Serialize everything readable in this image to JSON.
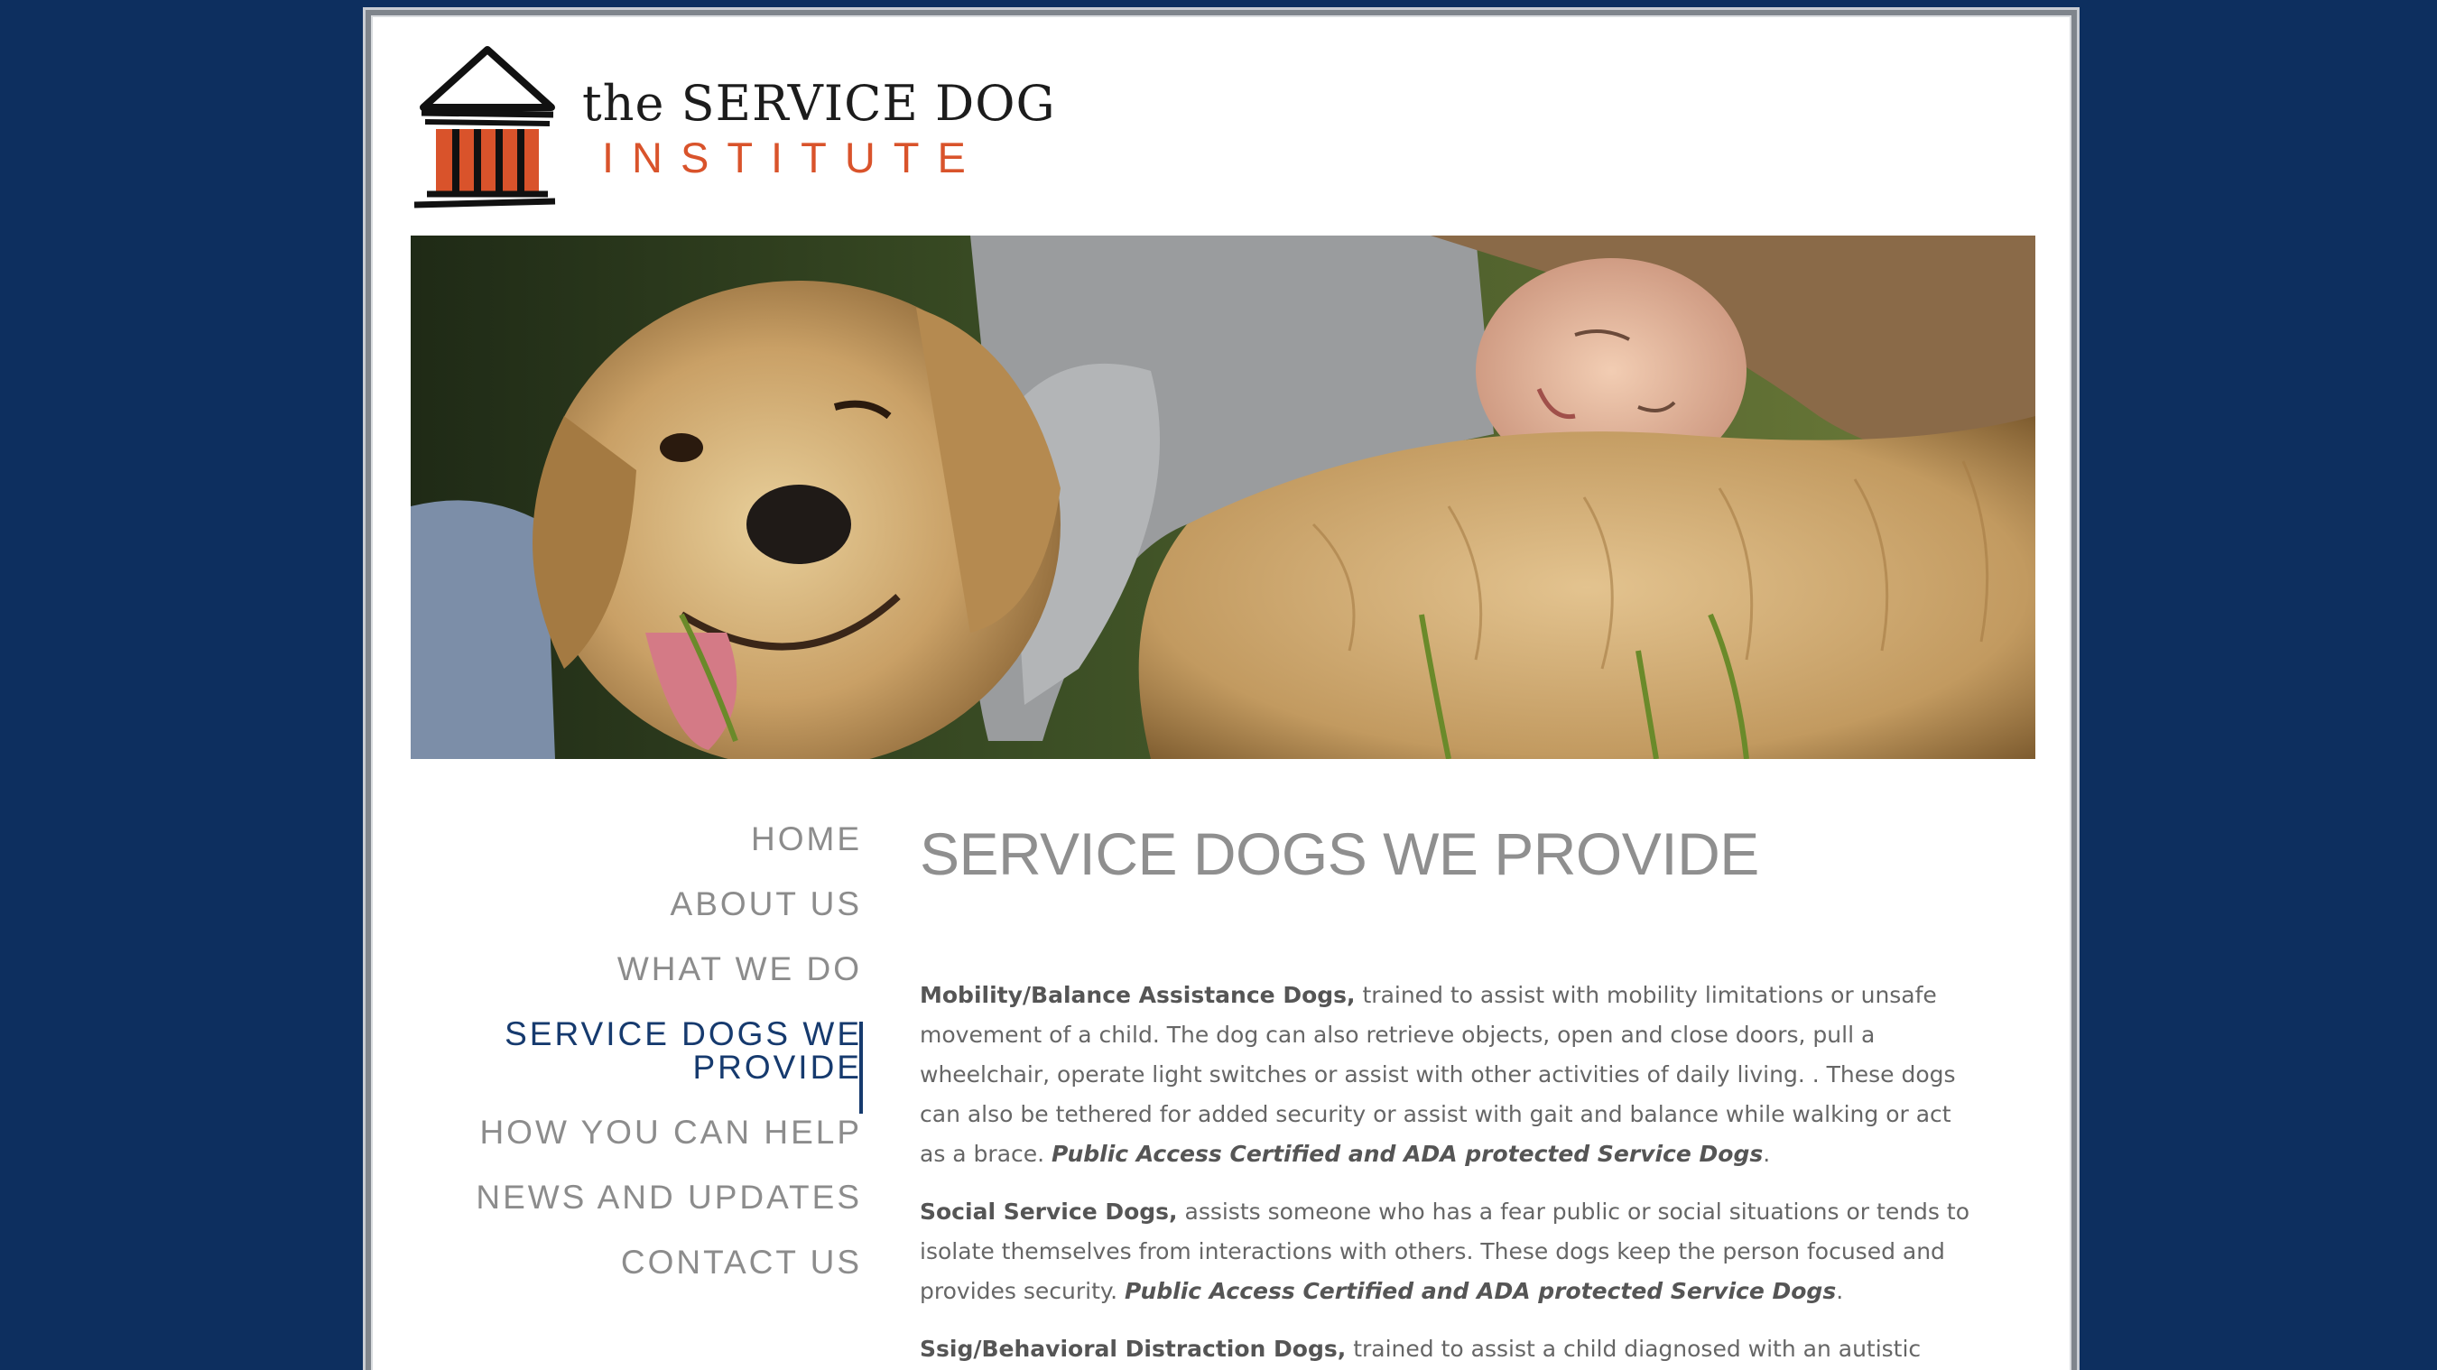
{
  "logo": {
    "line1": "the SERVICE DOG",
    "line2": "INSTITUTE",
    "brand_orange": "#d9532b"
  },
  "nav": {
    "items": [
      {
        "label": "HOME",
        "active": false
      },
      {
        "label": "ABOUT US",
        "active": false
      },
      {
        "label": "WHAT WE DO",
        "active": false
      },
      {
        "label": "SERVICE DOGS WE PROVIDE",
        "active": true
      },
      {
        "label": "HOW YOU CAN HELP",
        "active": false
      },
      {
        "label": "NEWS AND UPDATES",
        "active": false
      },
      {
        "label": "CONTACT US",
        "active": false
      }
    ],
    "active_color": "#163a6e",
    "inactive_color": "#8c8c8c"
  },
  "main": {
    "title": "SERVICE DOGS WE PROVIDE",
    "paragraphs": [
      {
        "heading": "Mobility/Balance Assistance Dogs,",
        "body": " trained to assist with mobility limitations or unsafe movement of a child.  The dog can also retrieve objects, open and close doors, pull a wheelchair, operate light switches or assist with other activities of daily living. . These dogs can also be tethered  for added security or assist  with gait and balance while walking or act as a brace.  ",
        "cert": "Public Access Certified and ADA protected Service Dogs",
        "tail": "."
      },
      {
        "heading": "Social Service Dogs,",
        "body": " assists someone who has a fear public or social situations or tends to isolate themselves from interactions with others.  These dogs keep the person focused and provides security. ",
        "cert": "Public Access Certified and ADA protected Service Dogs",
        "tail": "."
      },
      {
        "heading": "Ssig/Behavioral Distraction Dogs,",
        "body": " trained to assist a child diagnosed with an autistic spectrum",
        "cert": "",
        "tail": ""
      }
    ]
  },
  "colors": {
    "background": "#0d2f5f",
    "title_gray": "#8f8f8f",
    "body_gray": "#666666"
  }
}
